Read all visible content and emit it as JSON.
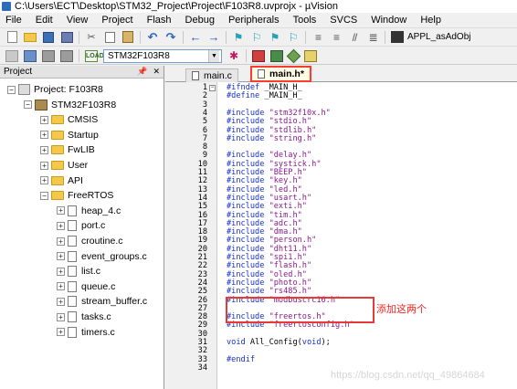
{
  "window": {
    "title": "C:\\Users\\ECT\\Desktop\\STM32_Project\\Project\\F103R8.uvprojx - µVision"
  },
  "menu": [
    "File",
    "Edit",
    "View",
    "Project",
    "Flash",
    "Debug",
    "Peripherals",
    "Tools",
    "SVCS",
    "Window",
    "Help"
  ],
  "toolbar": {
    "config_label": "APPL_asAdObj",
    "load_label": "LOAD"
  },
  "toolbar2": {
    "target": "STM32F103R8"
  },
  "project": {
    "panel_title": "Project",
    "root": "Project: F103R8",
    "target": "STM32F103R8",
    "groups": [
      "CMSIS",
      "Startup",
      "FwLIB",
      "User",
      "API"
    ],
    "freertos_group": "FreeRTOS",
    "freertos_files": [
      "heap_4.c",
      "port.c",
      "croutine.c",
      "event_groups.c",
      "list.c",
      "queue.c",
      "stream_buffer.c",
      "tasks.c",
      "timers.c"
    ]
  },
  "tabs": [
    {
      "label": "main.c",
      "active": false
    },
    {
      "label": "main.h*",
      "active": true
    }
  ],
  "code_lines": [
    {
      "n": "1",
      "parts": [
        [
          "kw",
          "#ifndef"
        ],
        [
          "mac",
          " _MAIN_H_"
        ]
      ]
    },
    {
      "n": "2",
      "parts": [
        [
          "kw",
          "#define"
        ],
        [
          "mac",
          " _MAIN_H_"
        ]
      ]
    },
    {
      "n": "3",
      "parts": []
    },
    {
      "n": "4",
      "parts": [
        [
          "kw",
          "#include"
        ],
        [
          "str",
          " \"stm32f10x.h\""
        ]
      ]
    },
    {
      "n": "5",
      "parts": [
        [
          "kw",
          "#include"
        ],
        [
          "str",
          " \"stdio.h\""
        ]
      ]
    },
    {
      "n": "6",
      "parts": [
        [
          "kw",
          "#include"
        ],
        [
          "str",
          " \"stdlib.h\""
        ]
      ]
    },
    {
      "n": "7",
      "parts": [
        [
          "kw",
          "#include"
        ],
        [
          "str",
          " \"string.h\""
        ]
      ]
    },
    {
      "n": "8",
      "parts": []
    },
    {
      "n": "9",
      "parts": [
        [
          "kw",
          "#include"
        ],
        [
          "str",
          " \"delay.h\""
        ]
      ]
    },
    {
      "n": "10",
      "parts": [
        [
          "kw",
          "#include"
        ],
        [
          "str",
          " \"systick.h\""
        ]
      ]
    },
    {
      "n": "11",
      "parts": [
        [
          "kw",
          "#include"
        ],
        [
          "str",
          " \"BEEP.h\""
        ]
      ]
    },
    {
      "n": "12",
      "parts": [
        [
          "kw",
          "#include"
        ],
        [
          "str",
          " \"key.h\""
        ]
      ]
    },
    {
      "n": "13",
      "parts": [
        [
          "kw",
          "#include"
        ],
        [
          "str",
          " \"led.h\""
        ]
      ]
    },
    {
      "n": "14",
      "parts": [
        [
          "kw",
          "#include"
        ],
        [
          "str",
          " \"usart.h\""
        ]
      ]
    },
    {
      "n": "15",
      "parts": [
        [
          "kw",
          "#include"
        ],
        [
          "str",
          " \"exti.h\""
        ]
      ]
    },
    {
      "n": "16",
      "parts": [
        [
          "kw",
          "#include"
        ],
        [
          "str",
          " \"tim.h\""
        ]
      ]
    },
    {
      "n": "17",
      "parts": [
        [
          "kw",
          "#include"
        ],
        [
          "str",
          " \"adc.h\""
        ]
      ]
    },
    {
      "n": "18",
      "parts": [
        [
          "kw",
          "#include"
        ],
        [
          "str",
          " \"dma.h\""
        ]
      ]
    },
    {
      "n": "19",
      "parts": [
        [
          "kw",
          "#include"
        ],
        [
          "str",
          " \"person.h\""
        ]
      ]
    },
    {
      "n": "20",
      "parts": [
        [
          "kw",
          "#include"
        ],
        [
          "str",
          " \"dht11.h\""
        ]
      ]
    },
    {
      "n": "21",
      "parts": [
        [
          "kw",
          "#include"
        ],
        [
          "str",
          " \"spi1.h\""
        ]
      ]
    },
    {
      "n": "22",
      "parts": [
        [
          "kw",
          "#include"
        ],
        [
          "str",
          " \"flash.h\""
        ]
      ]
    },
    {
      "n": "23",
      "parts": [
        [
          "kw",
          "#include"
        ],
        [
          "str",
          " \"oled.h\""
        ]
      ]
    },
    {
      "n": "24",
      "parts": [
        [
          "kw",
          "#include"
        ],
        [
          "str",
          " \"photo.h\""
        ]
      ]
    },
    {
      "n": "25",
      "parts": [
        [
          "kw",
          "#include"
        ],
        [
          "str",
          " \"rs485.h\""
        ]
      ]
    },
    {
      "n": "26",
      "parts": [
        [
          "kw",
          "#include"
        ],
        [
          "str",
          " \"modbuscrc16.h\""
        ]
      ]
    },
    {
      "n": "27",
      "parts": []
    },
    {
      "n": "28",
      "parts": [
        [
          "kw",
          "#include"
        ],
        [
          "str",
          " \"freertos.h\""
        ]
      ]
    },
    {
      "n": "29",
      "parts": [
        [
          "kw",
          "#include"
        ],
        [
          "str",
          " \"freertosconfig.h\""
        ]
      ]
    },
    {
      "n": "30",
      "parts": []
    },
    {
      "n": "31",
      "parts": [
        [
          "kw",
          "void"
        ],
        [
          "mac",
          " All_Config("
        ],
        [
          "kw",
          "void"
        ],
        [
          "mac",
          ");"
        ]
      ]
    },
    {
      "n": "32",
      "parts": []
    },
    {
      "n": "33",
      "parts": [
        [
          "kw",
          "#endif"
        ]
      ]
    },
    {
      "n": "34",
      "parts": []
    }
  ],
  "annotation": "添加这两个",
  "watermark": "https://blog.csdn.net/qq_49864684"
}
